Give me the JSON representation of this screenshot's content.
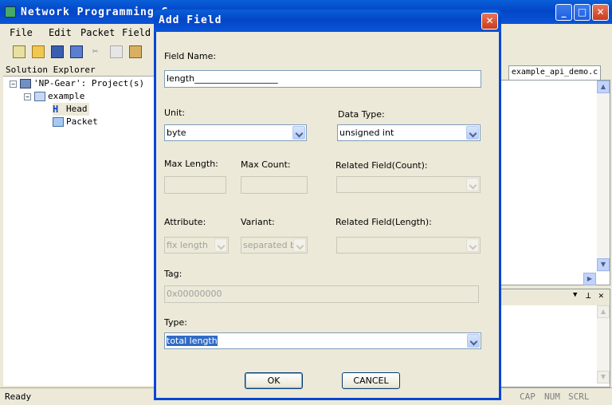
{
  "main_window": {
    "title": "Network Programming G",
    "menu": [
      "File",
      "Edit",
      "Packet",
      "Field"
    ],
    "controls": {
      "minimize": "_",
      "maximize": "□",
      "close": "✕"
    }
  },
  "solution_explorer": {
    "header": "Solution Explorer",
    "tree": {
      "project": "'NP-Gear': Project(s)",
      "example": "example",
      "head": "Head",
      "packet": "Packet"
    }
  },
  "editor": {
    "tab": "example_api_demo.c"
  },
  "status_bar": {
    "text": "Ready",
    "cap": "CAP",
    "num": "NUM",
    "scrl": "SCRL"
  },
  "dialog": {
    "title": "Add Field",
    "close": "✕",
    "field_name": {
      "label": "Field Name:",
      "value": "length___________________"
    },
    "unit": {
      "label": "Unit:",
      "value": "byte"
    },
    "data_type": {
      "label": "Data Type:",
      "value": "unsigned int"
    },
    "max_length": {
      "label": "Max Length:",
      "value": ""
    },
    "max_count": {
      "label": "Max Count:",
      "value": ""
    },
    "related_count": {
      "label": "Related Field(Count):",
      "value": ""
    },
    "attribute": {
      "label": "Attribute:",
      "value": "fix length"
    },
    "variant": {
      "label": "Variant:",
      "value": "separated by"
    },
    "related_length": {
      "label": "Related Field(Length):",
      "value": ""
    },
    "tag": {
      "label": "Tag:",
      "value": "0x00000000"
    },
    "type": {
      "label": "Type:",
      "value": "total length"
    },
    "ok": "OK",
    "cancel": "CANCEL"
  },
  "colors": {
    "titlebar": "#0a5fd8",
    "dialog_bg": "#ece9d8",
    "selection": "#316ac5",
    "close_button": "#c83c1c"
  }
}
